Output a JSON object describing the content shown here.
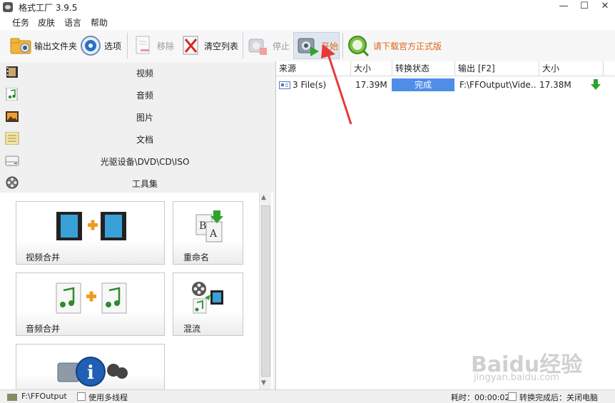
{
  "window": {
    "title": "格式工厂 3.9.5",
    "minimize": "—",
    "maximize": "☐",
    "close": "✕"
  },
  "menu": [
    "任务",
    "皮肤",
    "语言",
    "帮助"
  ],
  "toolbar": {
    "output_folder": "输出文件夹",
    "options": "选项",
    "remove": "移除",
    "clear_list": "清空列表",
    "stop": "停止",
    "start": "开始",
    "download_official": "请下载官方正式版"
  },
  "categories": [
    "视频",
    "音频",
    "图片",
    "文档",
    "光驱设备\\DVD\\CD\\ISO",
    "工具集"
  ],
  "tools": [
    "视频合并",
    "重命名",
    "音频合并",
    "混流"
  ],
  "table": {
    "headers": [
      "来源",
      "大小",
      "转换状态",
      "输出 [F2]",
      "大小"
    ],
    "rows": [
      {
        "source": "3 File(s)",
        "size": "17.39M",
        "status": "完成",
        "output": "F:\\FFOutput\\Vide...",
        "out_size": "17.38M"
      }
    ]
  },
  "statusbar": {
    "path": "F:\\FFOutput",
    "multithread": "使用多线程",
    "elapsed": "耗时：00:00:02",
    "after_done": "转换完成后：关闭电脑"
  },
  "watermark": {
    "brand": "Baidu经验",
    "url": "jingyan.baidu.com"
  },
  "colors": {
    "accent": "#4f8ee8",
    "download_text": "#e0661b",
    "arrow": "#e8393a"
  }
}
